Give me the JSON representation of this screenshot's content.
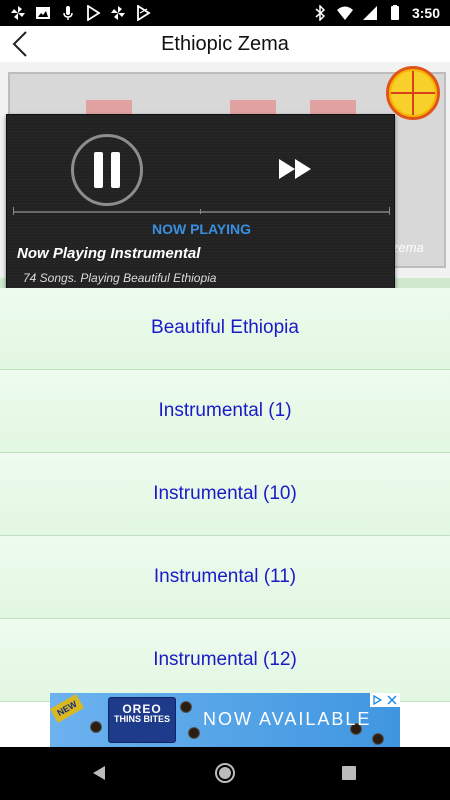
{
  "status_bar": {
    "time": "3:50",
    "left_icons": [
      "pinwheel-icon",
      "image-icon",
      "microphone-icon",
      "play-store-icon",
      "pinwheel-icon",
      "play-store-icon"
    ],
    "right_icons": [
      "bluetooth-icon",
      "wifi-icon",
      "signal-icon",
      "battery-icon"
    ]
  },
  "app_bar": {
    "title": "Ethiopic Zema"
  },
  "banner": {
    "partial_text": "zema"
  },
  "player": {
    "now_playing_label": "NOW PLAYING",
    "title": "Now Playing Instrumental",
    "subtitle": "74 Songs. Playing Beautiful Ethiopia",
    "accent_color": "#3a8fe0"
  },
  "songs": [
    {
      "label": "Beautiful Ethiopia"
    },
    {
      "label": "Instrumental (1)"
    },
    {
      "label": "Instrumental (10)"
    },
    {
      "label": "Instrumental (11)"
    },
    {
      "label": "Instrumental (12)"
    }
  ],
  "ad": {
    "badge": "NEW",
    "brand": "OREO",
    "product": "THINS BITES",
    "headline": "NOW AVAILABLE"
  },
  "colors": {
    "list_text": "#1a1ac8",
    "list_bg": "#e6f8e6",
    "status_bar_bg": "#000000",
    "nav_bar_bg": "#000000"
  }
}
